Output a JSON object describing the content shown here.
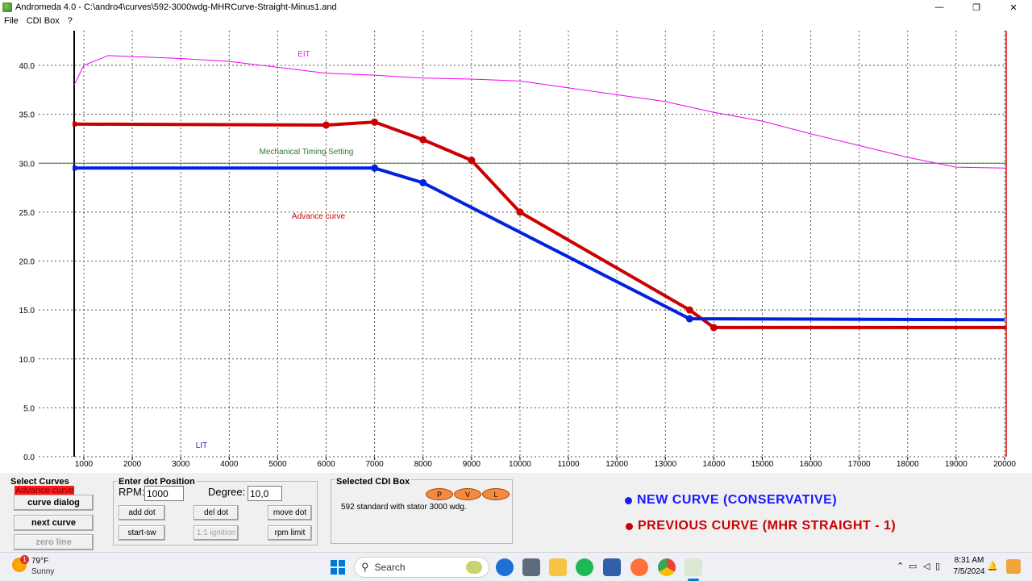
{
  "window": {
    "title": "Andromeda 4.0 - C:\\andro4\\curves\\592-3000wdg-MHRCurve-Straight-Minus1.and",
    "minimize_glyph": "—",
    "maximize_glyph": "❐",
    "close_glyph": "✕"
  },
  "menu": [
    "File",
    "CDI Box",
    "?"
  ],
  "chart_data": {
    "type": "line",
    "xlim": [
      800,
      20000
    ],
    "ylim": [
      0,
      42.5
    ],
    "x_ticks": [
      1000,
      2000,
      3000,
      4000,
      5000,
      6000,
      7000,
      8000,
      9000,
      10000,
      11000,
      12000,
      13000,
      14000,
      15000,
      16000,
      17000,
      18000,
      19000,
      20000
    ],
    "y_ticks": [
      0,
      5,
      10,
      15,
      20,
      25,
      30,
      35,
      40
    ],
    "y_tick_labels": [
      "0.0",
      "5.0",
      "10.0",
      "15.0",
      "20.0",
      "25.0",
      "30.0",
      "35.0",
      "40.0"
    ],
    "grid": true,
    "annotations": {
      "eit": "EIT",
      "lit": "LIT",
      "mechanical": "Mechanical Timing Setting",
      "advance": "Advance curve"
    },
    "mechanical_timing": 30.0,
    "series": [
      {
        "color": "#ee00ee",
        "points": [
          [
            800,
            38
          ],
          [
            1000,
            40
          ],
          [
            1500,
            41
          ],
          [
            2000,
            40.9
          ],
          [
            3000,
            40.7
          ],
          [
            4000,
            40.4
          ],
          [
            5000,
            39.8
          ],
          [
            6000,
            39.2
          ],
          [
            7000,
            39.0
          ],
          [
            8000,
            38.7
          ],
          [
            9000,
            38.6
          ],
          [
            10000,
            38.4
          ],
          [
            11000,
            37.7
          ],
          [
            12000,
            37.0
          ],
          [
            13000,
            36.3
          ],
          [
            14000,
            35.2
          ],
          [
            15000,
            34.3
          ],
          [
            16000,
            33.0
          ],
          [
            17000,
            31.8
          ],
          [
            18000,
            30.6
          ],
          [
            19000,
            29.6
          ],
          [
            20000,
            29.5
          ]
        ]
      },
      {
        "color": "#cc0000",
        "points": [
          [
            800,
            34.0
          ],
          [
            6000,
            33.9
          ],
          [
            7000,
            34.2
          ],
          [
            8000,
            32.4
          ],
          [
            9000,
            30.3
          ],
          [
            10000,
            25.0
          ],
          [
            13500,
            15.0
          ],
          [
            14000,
            13.2
          ],
          [
            20000,
            13.2
          ]
        ],
        "dots": [
          [
            6000,
            33.9
          ],
          [
            7000,
            34.2
          ],
          [
            8000,
            32.4
          ],
          [
            9000,
            30.3
          ],
          [
            10000,
            25.0
          ],
          [
            13500,
            15.0
          ],
          [
            14000,
            13.2
          ]
        ]
      },
      {
        "color": "#0022dd",
        "points": [
          [
            800,
            29.5
          ],
          [
            7000,
            29.5
          ],
          [
            8000,
            28.0
          ],
          [
            13500,
            14.1
          ],
          [
            20000,
            14.0
          ]
        ],
        "dots": [
          [
            7000,
            29.5
          ],
          [
            8000,
            28.0
          ],
          [
            13500,
            14.1
          ]
        ]
      }
    ]
  },
  "select_curves": {
    "title": "Select Curves",
    "selected": "Advance curve",
    "curve_dialog": "curve dialog",
    "next_curve": "next curve",
    "zero_line": "zero line"
  },
  "dot_position": {
    "title": "Enter dot Position",
    "rpm_label": "RPM:",
    "rpm_value": "1000",
    "degree_label": "Degree:",
    "degree_value": "10,0",
    "add_dot": "add dot",
    "del_dot": "del dot",
    "move_dot": "move dot",
    "start_sw": "start-sw",
    "ignition": "1:1 ignition",
    "rpm_limit": "rpm limit"
  },
  "cdi_box": {
    "title": "Selected CDI Box",
    "description": "592 standard with stator 3000 wdg.",
    "p": "P",
    "v": "V",
    "l": "L"
  },
  "legend": {
    "new_curve": "NEW CURVE (CONSERVATIVE)",
    "new_color": "#1a1aff",
    "previous_curve": "PREVIOUS CURVE (MHR STRAIGHT - 1)",
    "previous_color": "#cc0000"
  },
  "taskbar": {
    "temperature": "79°F",
    "condition": "Sunny",
    "weather_badge": "1",
    "search": "Search",
    "time": "8:31 AM",
    "date": "7/5/2024"
  }
}
